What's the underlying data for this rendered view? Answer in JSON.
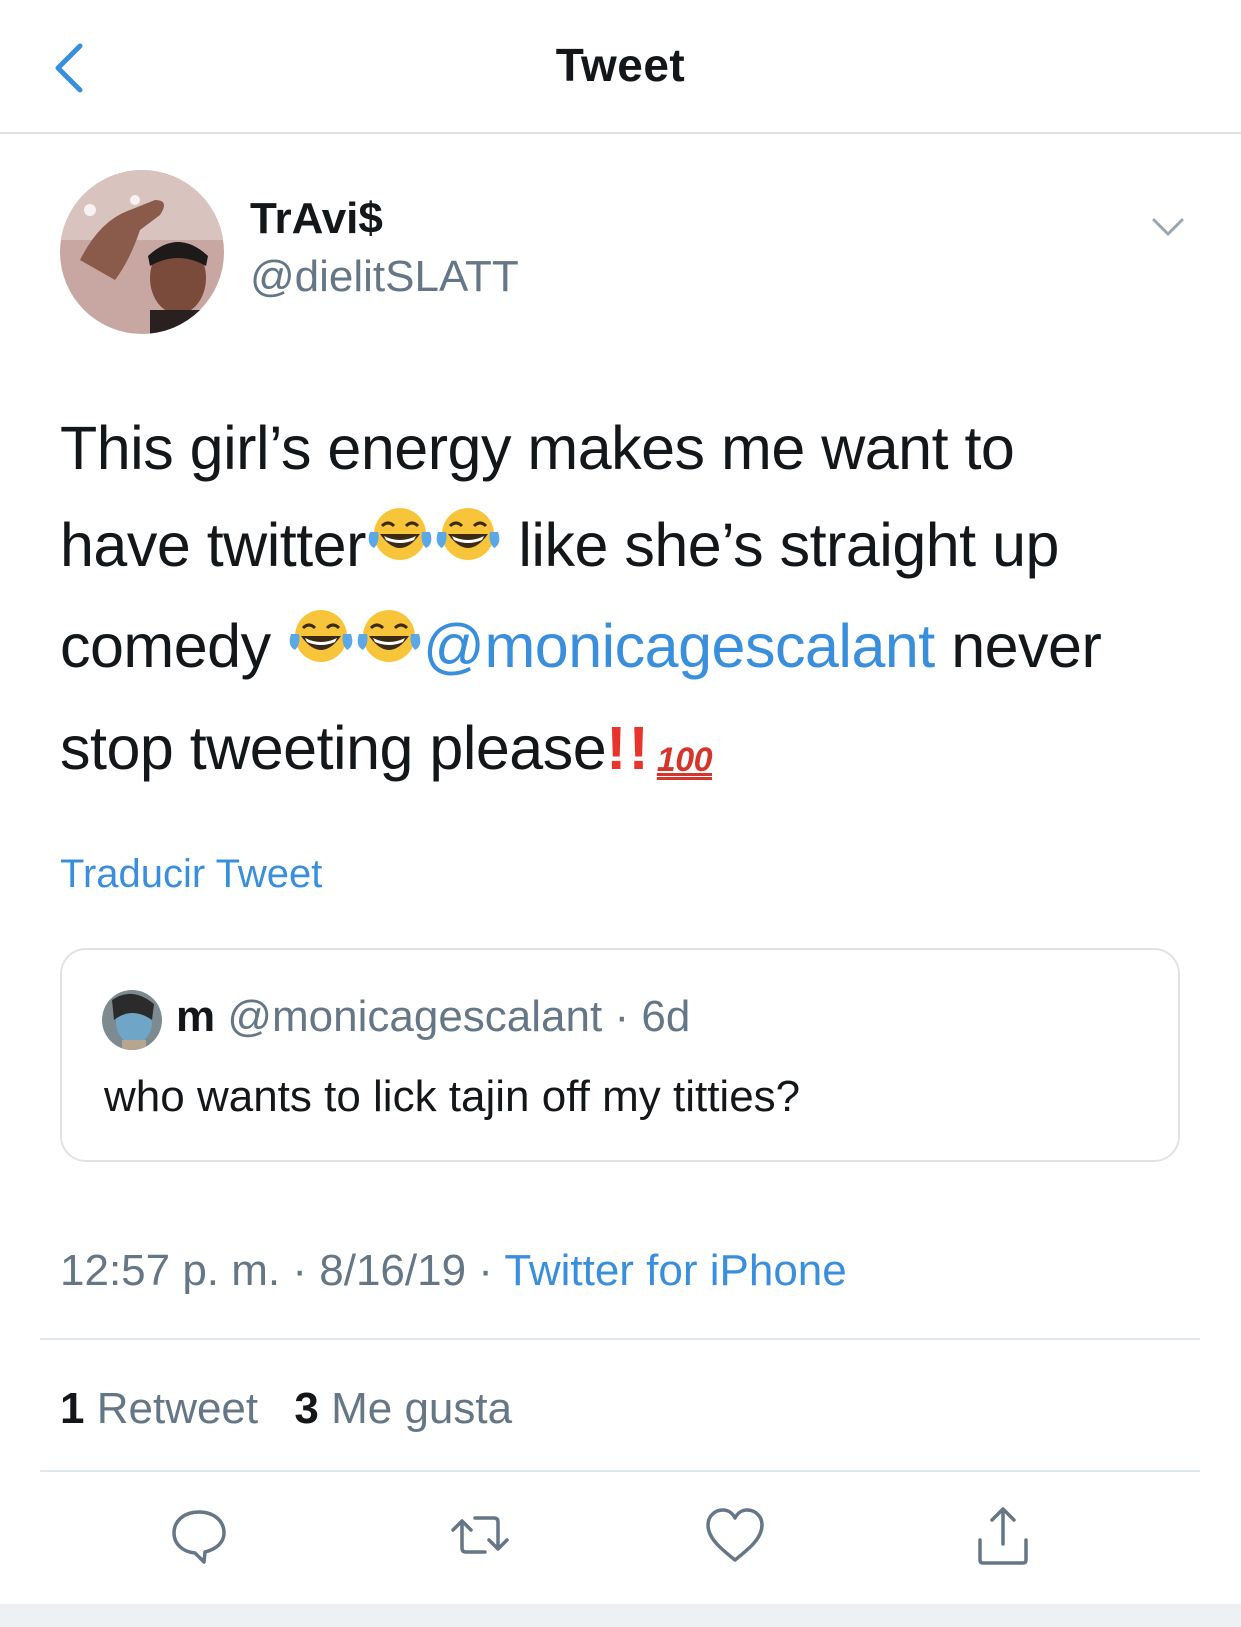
{
  "nav": {
    "title": "Tweet",
    "back_icon": "chevron-left-icon"
  },
  "author": {
    "display_name": "TrAvi$",
    "handle": "@dielitSLATT"
  },
  "tweet": {
    "line1": "This girl’s energy makes me want to",
    "line2_a": "have twitter",
    "line2_b": " like she’s straight up",
    "line3_a": "comedy ",
    "line3_mention": "@monicagescalant",
    "line3_b": " never",
    "line4_a": "stop tweeting please",
    "line4_excl": "!!",
    "line4_hundred": "100",
    "emojis": [
      "face-with-tears-of-joy",
      "face-with-tears-of-joy",
      "face-with-tears-of-joy",
      "face-with-tears-of-joy",
      "double-exclamation",
      "hundred-points"
    ]
  },
  "translate_label": "Traducir Tweet",
  "quote": {
    "name": "m",
    "handle": "@monicagescalant",
    "separator": "·",
    "time": "6d",
    "text": "who wants to lick tajin off my titties?"
  },
  "meta": {
    "time": "12:57 p. m.",
    "sep1": " · ",
    "date": "8/16/19",
    "sep2": " · ",
    "source": "Twitter for iPhone"
  },
  "stats": {
    "retweets_count": "1",
    "retweets_label": "Retweet",
    "likes_count": "3",
    "likes_label": "Me gusta"
  },
  "actions": [
    "reply-icon",
    "retweet-icon",
    "like-icon",
    "share-icon"
  ],
  "colors": {
    "link": "#3a8fdd",
    "secondary_text": "#657786",
    "primary_text": "#14171a",
    "divider": "#e1e8ed"
  }
}
